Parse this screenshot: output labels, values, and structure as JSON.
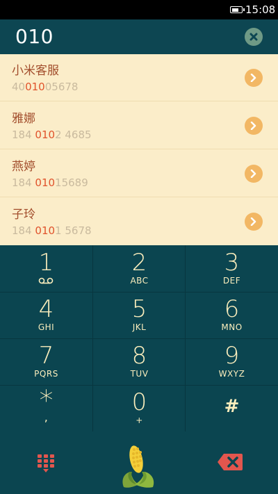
{
  "status_bar": {
    "time": "15:08",
    "battery_icon": "battery-icon",
    "battery_level": 0.8
  },
  "dial_input": {
    "value": "010",
    "clear_icon": "clear-circle-icon"
  },
  "results": [
    {
      "name": "小米客服",
      "number_pre": "40",
      "number_match": "010",
      "number_post": "05678"
    },
    {
      "name": "雅娜",
      "number_pre": "184 ",
      "number_match": "010",
      "number_post": "2 4685"
    },
    {
      "name": "燕婷",
      "number_pre": "184 ",
      "number_match": "010",
      "number_post": "15689"
    },
    {
      "name": "子玲",
      "number_pre": "184 ",
      "number_match": "010",
      "number_post": "1 5678"
    }
  ],
  "keypad": [
    {
      "digit": "1",
      "letters": ""
    },
    {
      "digit": "2",
      "letters": "ABC"
    },
    {
      "digit": "3",
      "letters": "DEF"
    },
    {
      "digit": "4",
      "letters": "GHI"
    },
    {
      "digit": "5",
      "letters": "JKL"
    },
    {
      "digit": "6",
      "letters": "MNO"
    },
    {
      "digit": "7",
      "letters": "PQRS"
    },
    {
      "digit": "8",
      "letters": "TUV"
    },
    {
      "digit": "9",
      "letters": "WXYZ"
    },
    {
      "digit": "*",
      "letters": ","
    },
    {
      "digit": "0",
      "letters": "+"
    },
    {
      "digit": "#",
      "letters": ""
    }
  ],
  "bottom_bar": {
    "dialpad_icon": "dialpad-grid-icon",
    "call_icon": "corn-call-icon",
    "delete_icon": "backspace-icon"
  },
  "colors": {
    "background": "#0b4550",
    "results_bg": "#fbedc9",
    "name_text": "#a24d2c",
    "match_highlight": "#e0532c",
    "arrow_button": "#f2b764",
    "key_text": "#fbeebd",
    "delete_icon": "#e2564e"
  }
}
